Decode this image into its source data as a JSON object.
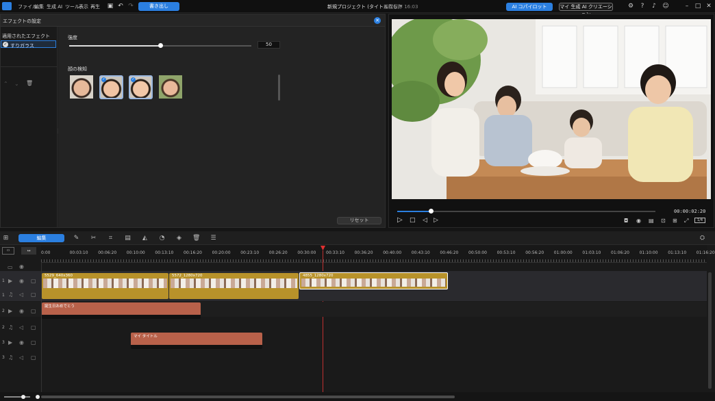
{
  "menu": {
    "items": [
      "ファイル",
      "編集",
      "生成 AI",
      "ツール",
      "表示",
      "再生"
    ],
    "export_label": "書き出し",
    "project_title": "新規プロジェクト (タイトルなし)*",
    "save_status": "前回保存 16:03",
    "ai_copilot_label": "AI コパイロット",
    "ai_creation_label": "マイ 生成 AI クリエーション"
  },
  "effect_panel": {
    "title": "エフェクトの設定",
    "applied_effects_title": "適用されたエフェクト",
    "applied_effect_item": "すりガラス",
    "strength_label": "強度",
    "strength_value": "50",
    "face_detect_label": "顔の検知",
    "reset_label": "リセット"
  },
  "preview": {
    "timecode": "00:00:02:20",
    "quality_badge": "1/4",
    "progress": 0.13
  },
  "timeline": {
    "edit_tab_label": "編集",
    "ruler_ticks": [
      "0:00",
      "00:03:10",
      "00:06:20",
      "00:10:00",
      "00:13:10",
      "00:16:20",
      "00:20:00",
      "00:23:10",
      "00:26:20",
      "00:30:00",
      "00:33:10",
      "00:36:20",
      "00:40:00",
      "00:43:10",
      "00:46:20",
      "00:50:00",
      "00:53:10",
      "00:56:20",
      "01:00:00",
      "01:03:10",
      "01:06:20",
      "01:10:00",
      "01:13:10",
      "01:16:20"
    ],
    "tracks": [
      {
        "num": "1",
        "kind": "video"
      },
      {
        "num": "1",
        "kind": "audio"
      },
      {
        "num": "2",
        "kind": "video"
      },
      {
        "num": "2",
        "kind": "audio"
      },
      {
        "num": "3",
        "kind": "video"
      },
      {
        "num": "3",
        "kind": "audio"
      }
    ],
    "clips": {
      "video1": [
        "5529_640x360",
        "5572_1280x720",
        "4855_1280x720"
      ],
      "title1": "誕生日おめでとう",
      "title3": "マイ タイトル"
    }
  },
  "colors": {
    "accent": "#2b7fe0",
    "video_clip": "#b8922a",
    "title_clip": "#b8614a",
    "playhead": "#e03030"
  },
  "icons": {
    "app_logo": "app-logo-icon",
    "settings": "gear-icon",
    "help": "help-icon",
    "notify": "bell-icon",
    "account": "user-icon"
  }
}
